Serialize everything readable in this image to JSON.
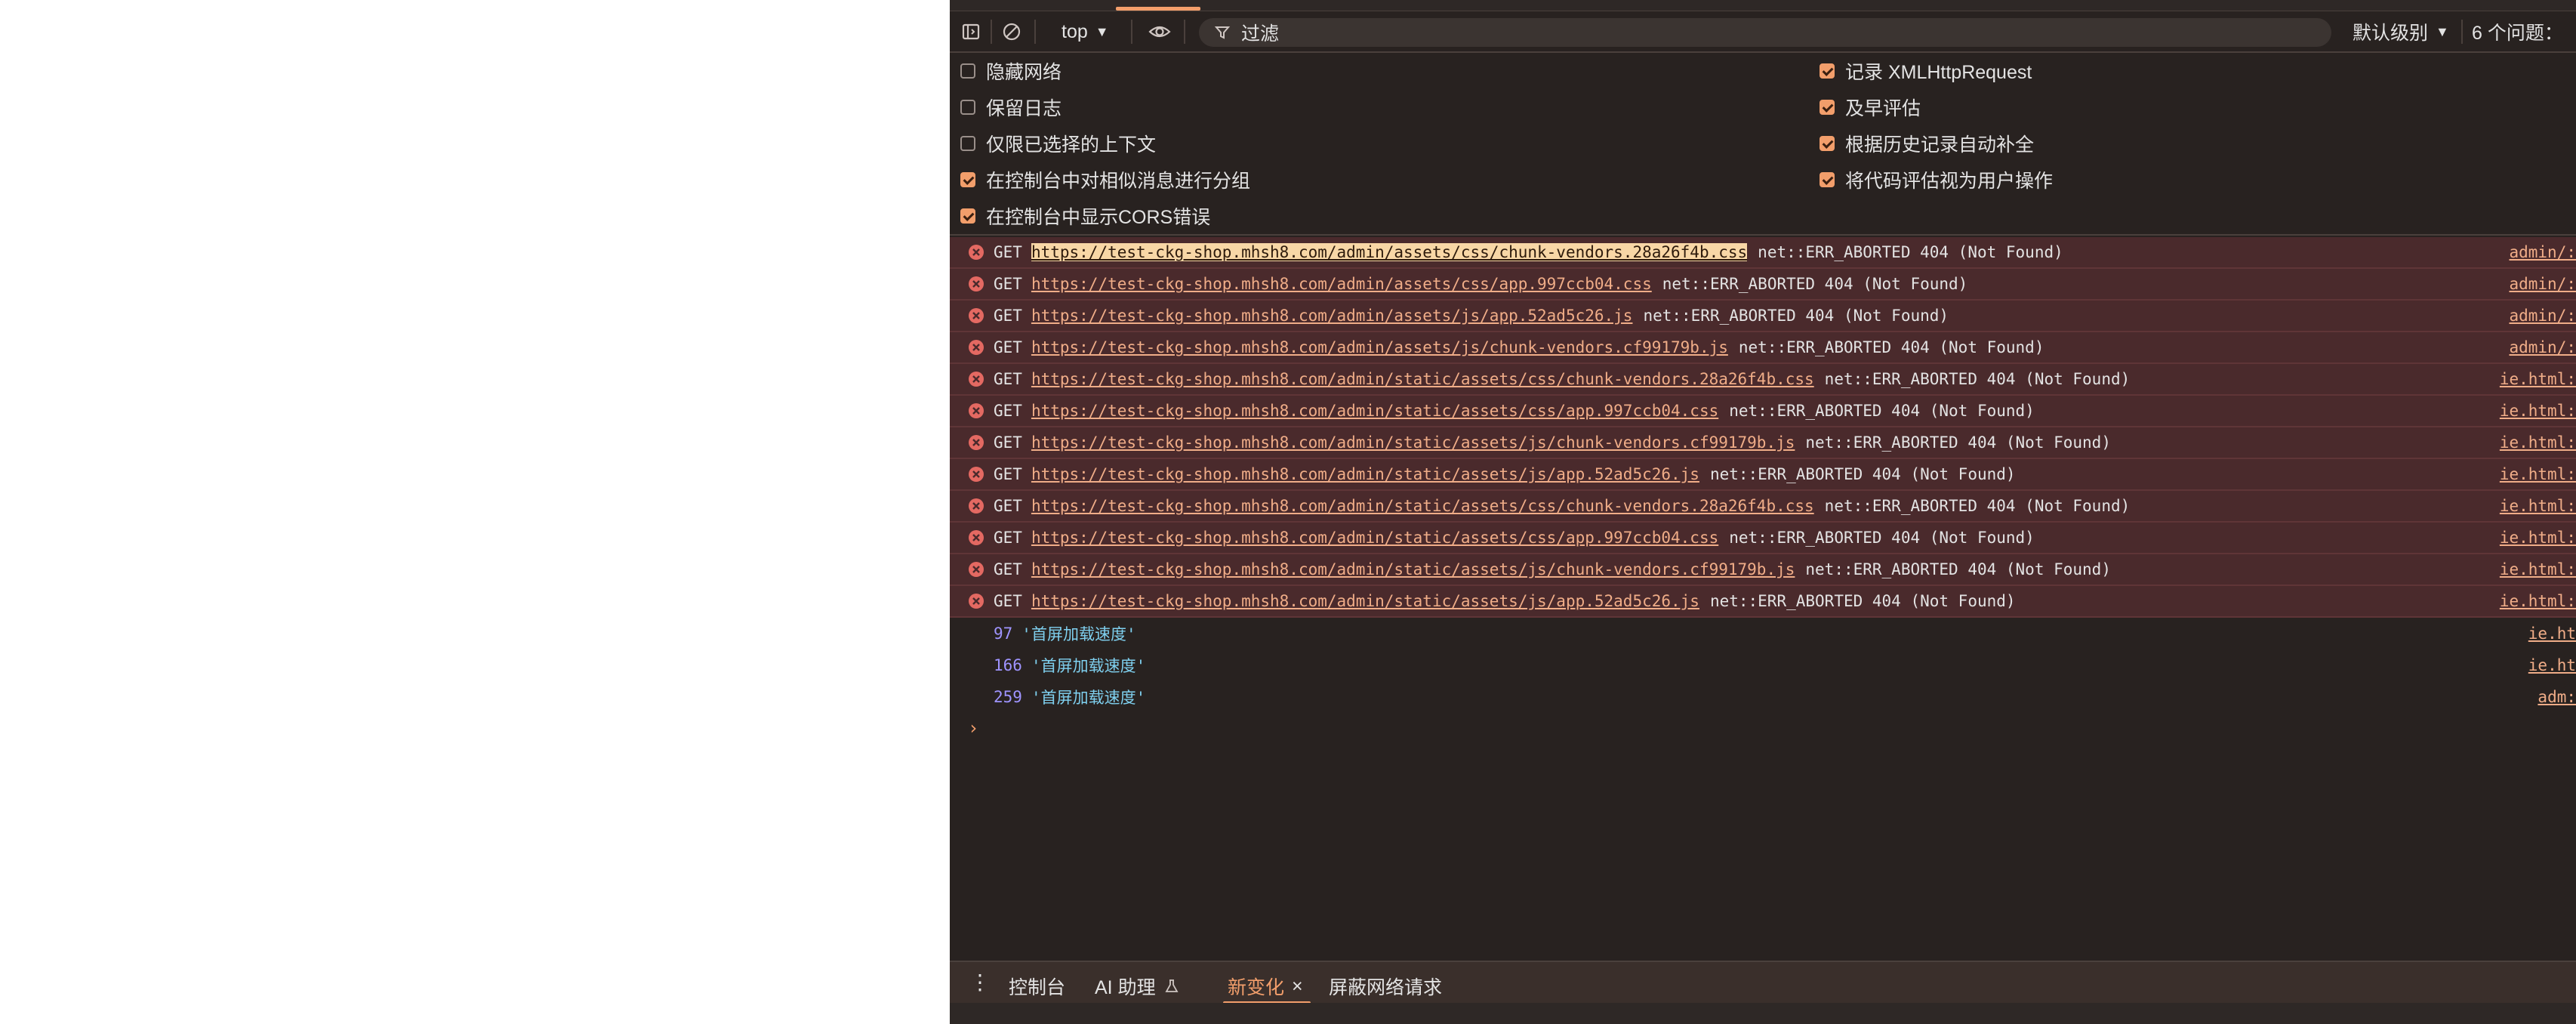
{
  "toolbar": {
    "context": "top",
    "filter_placeholder": "过滤",
    "level": "默认级别",
    "issues": "6 个问题："
  },
  "icons": {
    "sidebar": "sidebar-toggle-icon",
    "clear": "clear-console-icon",
    "eye": "live-expression-eye-icon",
    "filter": "filter-icon",
    "error": "error-circle-icon",
    "menu": "kebab-menu-icon",
    "flask": "flask-icon",
    "close": "close-icon"
  },
  "settings": {
    "left": [
      {
        "label": "隐藏网络",
        "checked": false
      },
      {
        "label": "保留日志",
        "checked": false
      },
      {
        "label": "仅限已选择的上下文",
        "checked": false
      },
      {
        "label": "在控制台中对相似消息进行分组",
        "checked": true
      },
      {
        "label": "在控制台中显示CORS错误",
        "checked": true
      }
    ],
    "right": [
      {
        "label": "记录 XMLHttpRequest",
        "checked": true
      },
      {
        "label": "及早评估",
        "checked": true
      },
      {
        "label": "根据历史记录自动补全",
        "checked": true
      },
      {
        "label": "将代码评估视为用户操作",
        "checked": true
      }
    ]
  },
  "errors": [
    {
      "method": "GET",
      "url": "https://test-ckg-shop.mhsh8.com/admin/assets/css/chunk-vendors.28a26f4b.css",
      "message": "net::ERR_ABORTED 404 (Not Found)",
      "source": "admin/:"
    },
    {
      "method": "GET",
      "url": "https://test-ckg-shop.mhsh8.com/admin/assets/css/app.997ccb04.css",
      "message": "net::ERR_ABORTED 404 (Not Found)",
      "source": "admin/:"
    },
    {
      "method": "GET",
      "url": "https://test-ckg-shop.mhsh8.com/admin/assets/js/app.52ad5c26.js",
      "message": "net::ERR_ABORTED 404 (Not Found)",
      "source": "admin/:"
    },
    {
      "method": "GET",
      "url": "https://test-ckg-shop.mhsh8.com/admin/assets/js/chunk-vendors.cf99179b.js",
      "message": "net::ERR_ABORTED 404 (Not Found)",
      "source": "admin/:"
    },
    {
      "method": "GET",
      "url": "https://test-ckg-shop.mhsh8.com/admin/static/assets/css/chunk-vendors.28a26f4b.css",
      "message": "net::ERR_ABORTED 404 (Not Found)",
      "source": "ie.html:"
    },
    {
      "method": "GET",
      "url": "https://test-ckg-shop.mhsh8.com/admin/static/assets/css/app.997ccb04.css",
      "message": "net::ERR_ABORTED 404 (Not Found)",
      "source": "ie.html:"
    },
    {
      "method": "GET",
      "url": "https://test-ckg-shop.mhsh8.com/admin/static/assets/js/chunk-vendors.cf99179b.js",
      "message": "net::ERR_ABORTED 404 (Not Found)",
      "source": "ie.html:"
    },
    {
      "method": "GET",
      "url": "https://test-ckg-shop.mhsh8.com/admin/static/assets/js/app.52ad5c26.js",
      "message": "net::ERR_ABORTED 404 (Not Found)",
      "source": "ie.html:"
    },
    {
      "method": "GET",
      "url": "https://test-ckg-shop.mhsh8.com/admin/static/assets/css/chunk-vendors.28a26f4b.css",
      "message": "net::ERR_ABORTED 404 (Not Found)",
      "source": "ie.html:"
    },
    {
      "method": "GET",
      "url": "https://test-ckg-shop.mhsh8.com/admin/static/assets/css/app.997ccb04.css",
      "message": "net::ERR_ABORTED 404 (Not Found)",
      "source": "ie.html:"
    },
    {
      "method": "GET",
      "url": "https://test-ckg-shop.mhsh8.com/admin/static/assets/js/chunk-vendors.cf99179b.js",
      "message": "net::ERR_ABORTED 404 (Not Found)",
      "source": "ie.html:"
    },
    {
      "method": "GET",
      "url": "https://test-ckg-shop.mhsh8.com/admin/static/assets/js/app.52ad5c26.js",
      "message": "net::ERR_ABORTED 404 (Not Found)",
      "source": "ie.html:"
    }
  ],
  "logs": [
    {
      "number": "97",
      "text": "'首屏加载速度'",
      "source": "ie.ht"
    },
    {
      "number": "166",
      "text": "'首屏加载速度'",
      "source": "ie.ht"
    },
    {
      "number": "259",
      "text": "'首屏加载速度'",
      "source": "adm:"
    }
  ],
  "prompt": "›",
  "drawer": {
    "tabs": [
      {
        "label": "控制台"
      },
      {
        "label": "AI 助理"
      },
      {
        "label": "新变化",
        "active": true
      },
      {
        "label": "屏蔽网络请求"
      }
    ],
    "close_glyph": "×"
  },
  "colors": {
    "panel_bg": "#282220",
    "error_row_bg": "#4a2a2c",
    "accent": "#f29e6b",
    "link": "#f0ad88",
    "log_number": "#9f94ff",
    "log_string": "#7fd0ef"
  }
}
